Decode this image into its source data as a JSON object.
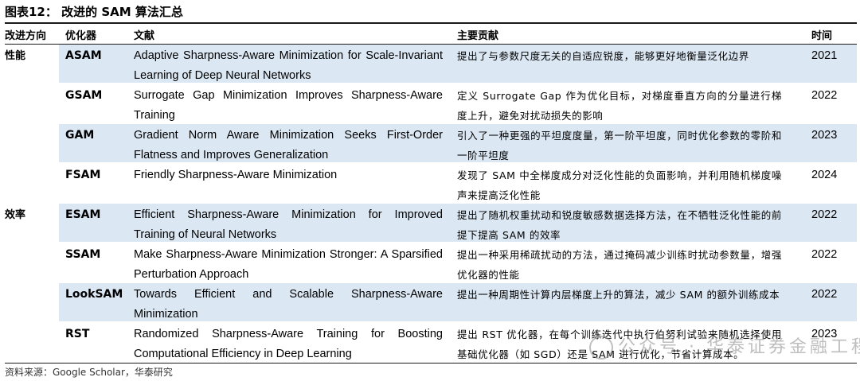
{
  "title": "图表12：  改进的 SAM 算法汇总",
  "headers": {
    "direction": "改进方向",
    "optimizer": "优化器",
    "paper": "文献",
    "contribution": "主要贡献",
    "year": "时间"
  },
  "rows": [
    {
      "direction": "性能",
      "optimizer": "ASAM",
      "paper": "Adaptive Sharpness-Aware Minimization for Scale-Invariant Learning of Deep Neural Networks",
      "contribution": "提出了与参数尺度无关的自适应锐度，能够更好地衡量泛化边界",
      "year": "2021"
    },
    {
      "direction": "",
      "optimizer": "GSAM",
      "paper": "Surrogate Gap Minimization Improves Sharpness-Aware Training",
      "contribution": "定义 Surrogate Gap 作为优化目标，对梯度垂直方向的分量进行梯度上升，避免对扰动损失的影响",
      "year": "2022"
    },
    {
      "direction": "",
      "optimizer": "GAM",
      "paper": "Gradient Norm Aware Minimization Seeks First-Order Flatness and Improves Generalization",
      "contribution": "引入了一种更强的平坦度度量，第一阶平坦度，同时优化参数的零阶和一阶平坦度",
      "year": "2023"
    },
    {
      "direction": "",
      "optimizer": "FSAM",
      "paper": "Friendly Sharpness-Aware Minimization",
      "contribution": "发现了 SAM 中全梯度成分对泛化性能的负面影响，并利用随机梯度噪声来提高泛化性能",
      "year": "2024"
    },
    {
      "direction": "效率",
      "optimizer": "ESAM",
      "paper": "Efficient Sharpness-Aware Minimization for Improved Training of Neural Networks",
      "contribution": "提出了随机权重扰动和锐度敏感数据选择方法，在不牺牲泛化性能的前提下提高 SAM 的效率",
      "year": "2022"
    },
    {
      "direction": "",
      "optimizer": "SSAM",
      "paper": "Make Sharpness-Aware Minimization Stronger: A Sparsified Perturbation Approach",
      "contribution": "提出一种采用稀疏扰动的方法，通过掩码减少训练时扰动参数量，增强优化器的性能",
      "year": "2022"
    },
    {
      "direction": "",
      "optimizer": "LookSAM",
      "paper": "Towards Efficient and Scalable Sharpness-Aware Minimization",
      "contribution": "提出一种周期性计算内层梯度上升的算法，减少 SAM 的额外训练成本",
      "year": "2022"
    },
    {
      "direction": "",
      "optimizer": "RST",
      "paper": "Randomized Sharpness-Aware Training for Boosting Computational Efficiency in Deep Learning",
      "contribution": "提出 RST 优化器，在每个训练迭代中执行伯努利试验来随机选择使用基础优化器（如 SGD）还是 SAM 进行优化，节省计算成本。",
      "year": "2023"
    }
  ],
  "source": "资料来源：Google Scholar，华泰研究",
  "watermark": "公众号 · 华泰证券金融工程"
}
